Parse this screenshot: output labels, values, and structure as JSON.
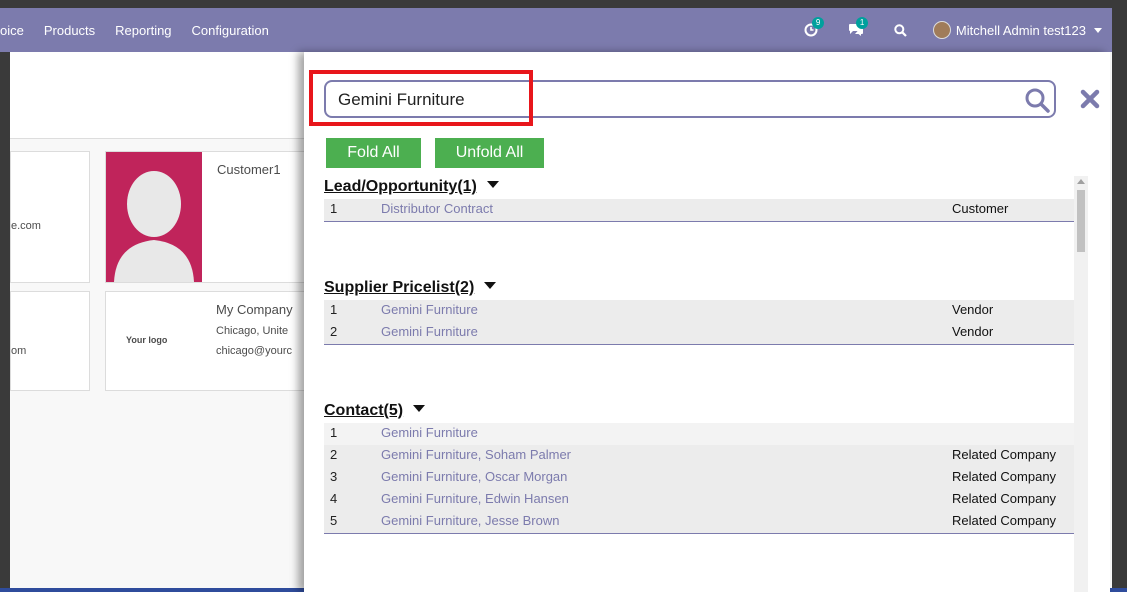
{
  "navbar": {
    "menu": [
      "oice",
      "Products",
      "Reporting",
      "Configuration"
    ],
    "activity_count": "9",
    "messages_count": "1",
    "user": "Mitchell Admin test123"
  },
  "background": {
    "card1": {
      "email_partial": "e.com"
    },
    "card2": {
      "name": "Customer1"
    },
    "card3": {
      "email_partial": "om"
    },
    "card4": {
      "logo": "Your logo",
      "name": "My Company",
      "city": "Chicago, Unite",
      "email": "chicago@yourc"
    }
  },
  "panel": {
    "search": {
      "value": "Gemini Furniture"
    },
    "fold_label": "Fold All",
    "unfold_label": "Unfold All",
    "sections": [
      {
        "title": "Lead/Opportunity(1)",
        "rows": [
          {
            "num": "1",
            "name": "Distributor Contract",
            "type": "Customer"
          }
        ]
      },
      {
        "title": "Supplier Pricelist(2)",
        "rows": [
          {
            "num": "1",
            "name": "Gemini Furniture",
            "type": "Vendor"
          },
          {
            "num": "2",
            "name": "Gemini Furniture",
            "type": "Vendor"
          }
        ]
      },
      {
        "title": "Contact(5)",
        "rows": [
          {
            "num": "1",
            "name": "Gemini Furniture",
            "type": ""
          },
          {
            "num": "2",
            "name": "Gemini Furniture, Soham Palmer",
            "type": "Related Company"
          },
          {
            "num": "3",
            "name": "Gemini Furniture, Oscar Morgan",
            "type": "Related Company"
          },
          {
            "num": "4",
            "name": "Gemini Furniture, Edwin Hansen",
            "type": "Related Company"
          },
          {
            "num": "5",
            "name": "Gemini Furniture, Jesse Brown",
            "type": "Related Company"
          }
        ]
      }
    ]
  },
  "colors": {
    "brand": "#7c7bad",
    "button": "#4caf50",
    "highlight": "#e8161b"
  }
}
